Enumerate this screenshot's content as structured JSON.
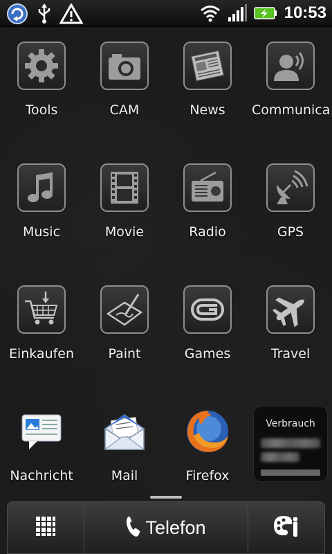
{
  "status_bar": {
    "time": "10:53",
    "icons": [
      "sync-app-icon",
      "usb-icon",
      "warning-icon",
      "wifi-icon",
      "signal-icon",
      "battery-charging-icon"
    ]
  },
  "apps": [
    {
      "label": "Tools",
      "icon": "gear-icon"
    },
    {
      "label": "CAM",
      "icon": "camera-icon"
    },
    {
      "label": "News",
      "icon": "newspaper-icon"
    },
    {
      "label": "Communica",
      "icon": "contact-speaker-icon"
    },
    {
      "label": "Music",
      "icon": "music-note-icon"
    },
    {
      "label": "Movie",
      "icon": "film-strip-icon"
    },
    {
      "label": "Radio",
      "icon": "radio-icon"
    },
    {
      "label": "GPS",
      "icon": "satellite-dish-icon"
    },
    {
      "label": "Einkaufen",
      "icon": "shopping-cart-icon"
    },
    {
      "label": "Paint",
      "icon": "pen-tablet-icon"
    },
    {
      "label": "Games",
      "icon": "gameloft-icon"
    },
    {
      "label": "Travel",
      "icon": "airplane-icon"
    },
    {
      "label": "Nachricht",
      "icon": "message-icon"
    },
    {
      "label": "Mail",
      "icon": "mail-envelope-icon"
    },
    {
      "label": "Firefox",
      "icon": "firefox-icon"
    }
  ],
  "widget": {
    "title": "Verbrauch"
  },
  "dock": {
    "left_icon": "app-drawer-icon",
    "telefon_label": "Telefon",
    "right_icon": "personalize-icon"
  }
}
